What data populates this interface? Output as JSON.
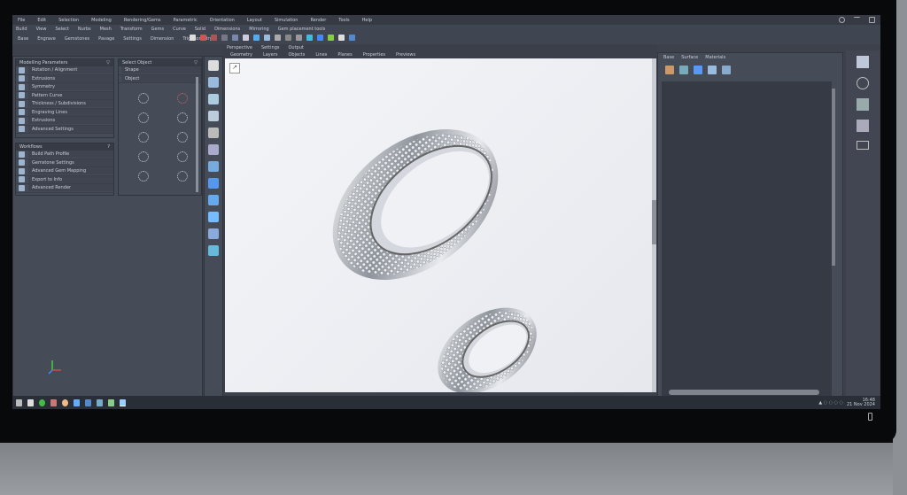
{
  "menu": [
    "File",
    "Edit",
    "Selection",
    "Modeling",
    "Rendering/Gems",
    "Parametric",
    "Orientation",
    "Layout",
    "Simulation",
    "Render",
    "Tools",
    "Help"
  ],
  "toolbar_row1": [
    "Build",
    "View",
    "Select",
    "Nurbs",
    "Mesh",
    "Transform",
    "Gems",
    "Curve",
    "Solid",
    "Dimensions",
    "Mirroring",
    "Gem placement tools"
  ],
  "toolbar_row2": [
    "Base",
    "Engrave",
    "Gemstones",
    "Pavage",
    "Settings",
    "Dimension",
    "Trigonometry"
  ],
  "viewport_tabs": [
    "Perspective",
    "Settings",
    "Output"
  ],
  "viewport_subtabs": [
    "Geometry",
    "Layers",
    "Objects",
    "Lines",
    "Planes",
    "Properties",
    "Previews"
  ],
  "left_panel": {
    "title": "Modelling Parameters",
    "items": [
      "Rotation / Alignment",
      "Extrusions",
      "Symmetry",
      "Pattern Curve",
      "Thickness / Subdivisions",
      "Engraving Lines",
      "Extrusions",
      "Advanced Settings"
    ],
    "section2_title": "Workflows",
    "items2": [
      "Build Path Profile",
      "Gemstone Settings",
      "Advanced Gem Mapping",
      "Export to Info",
      "Advanced Render"
    ]
  },
  "gem_panel": {
    "title": "Select Object",
    "fields": [
      "Shape",
      "Object"
    ]
  },
  "right_panel": {
    "tabs": [
      "Base",
      "Surface",
      "Materials"
    ]
  },
  "tray": {
    "time": "16:48",
    "date": "21 Nov 2024"
  }
}
